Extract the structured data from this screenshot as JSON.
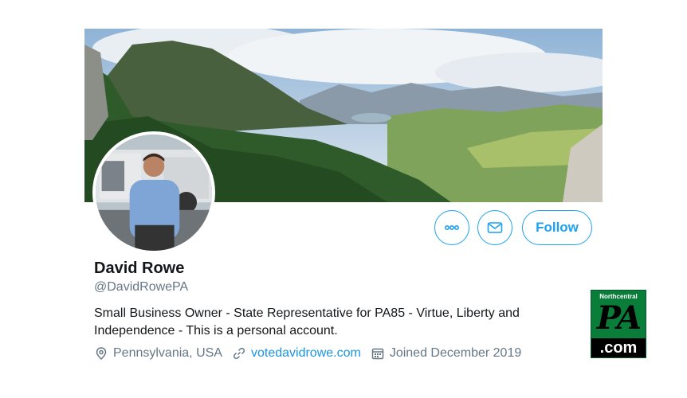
{
  "profile": {
    "name": "David Rowe",
    "handle": "@DavidRowePA",
    "bio": "Small Business Owner - State Representative for PA85 - Virtue, Liberty and Independence - This is a personal account.",
    "location": "Pennsylvania, USA",
    "website": "votedavidrowe.com",
    "joined": "Joined December 2019"
  },
  "actions": {
    "more_icon": "more-horizontal-icon",
    "message_icon": "envelope-icon",
    "follow_label": "Follow"
  },
  "meta_icons": {
    "location": "location-pin-icon",
    "link": "link-icon",
    "calendar": "calendar-icon"
  },
  "logo": {
    "top": "Northcentral",
    "mid": "PA",
    "bottom": ".com"
  },
  "colors": {
    "accent": "#1da1f2",
    "link": "#1b95e0",
    "secondary_text": "#657786",
    "logo_green": "#0a7d3a"
  }
}
